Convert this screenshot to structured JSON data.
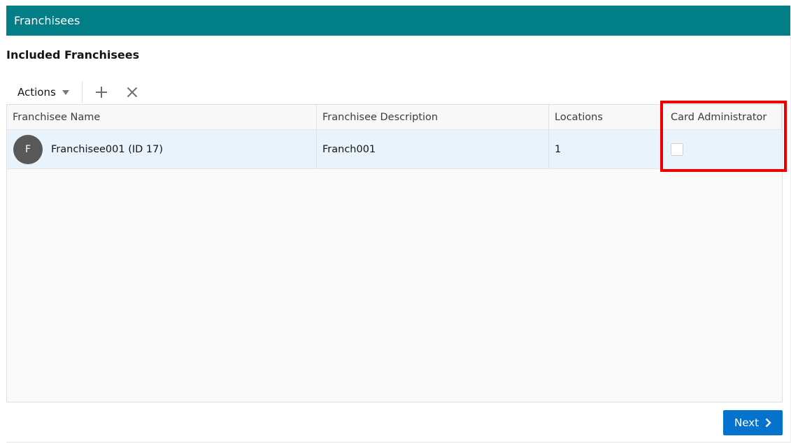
{
  "panel": {
    "title": "Franchisees"
  },
  "section": {
    "title": "Included Franchisees"
  },
  "toolbar": {
    "actions_label": "Actions",
    "actions_icon": "caret-down-icon",
    "add_icon": "plus-icon",
    "remove_icon": "close-icon"
  },
  "table": {
    "columns": [
      "Franchisee Name",
      "Franchisee Description",
      "Locations",
      "Card Administrator"
    ],
    "rows": [
      {
        "avatar_initial": "F",
        "name": "Franchisee001 (ID 17)",
        "description": "Franch001",
        "locations": "1",
        "card_administrator": false
      }
    ]
  },
  "footer": {
    "next_label": "Next",
    "next_icon": "chevron-right-icon"
  },
  "colors": {
    "header_bg": "#017e86",
    "primary_button": "#0572ce",
    "selected_row": "#e8f3fb",
    "highlight": "#ec0000",
    "avatar_bg": "#585858"
  }
}
